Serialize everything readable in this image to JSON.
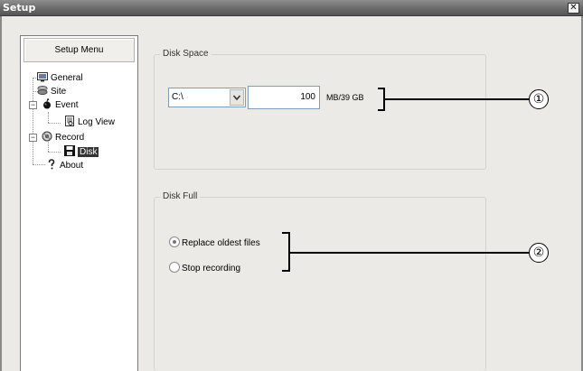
{
  "window": {
    "title": "Setup",
    "close_glyph": "✕"
  },
  "menu": {
    "header": "Setup Menu"
  },
  "tree": {
    "general": "General",
    "site": "Site",
    "event": "Event",
    "log_view": "Log View",
    "record": "Record",
    "disk": "Disk",
    "about": "About",
    "expander_glyph": "−"
  },
  "disk_space": {
    "title": "Disk Space",
    "drive": "C:\\",
    "size_value": "100",
    "unit": "MB/39 GB"
  },
  "disk_full": {
    "title": "Disk Full",
    "options": [
      "Replace oldest files",
      "Stop recording"
    ],
    "selected": "Replace oldest files"
  },
  "callouts": [
    "①",
    "②"
  ]
}
